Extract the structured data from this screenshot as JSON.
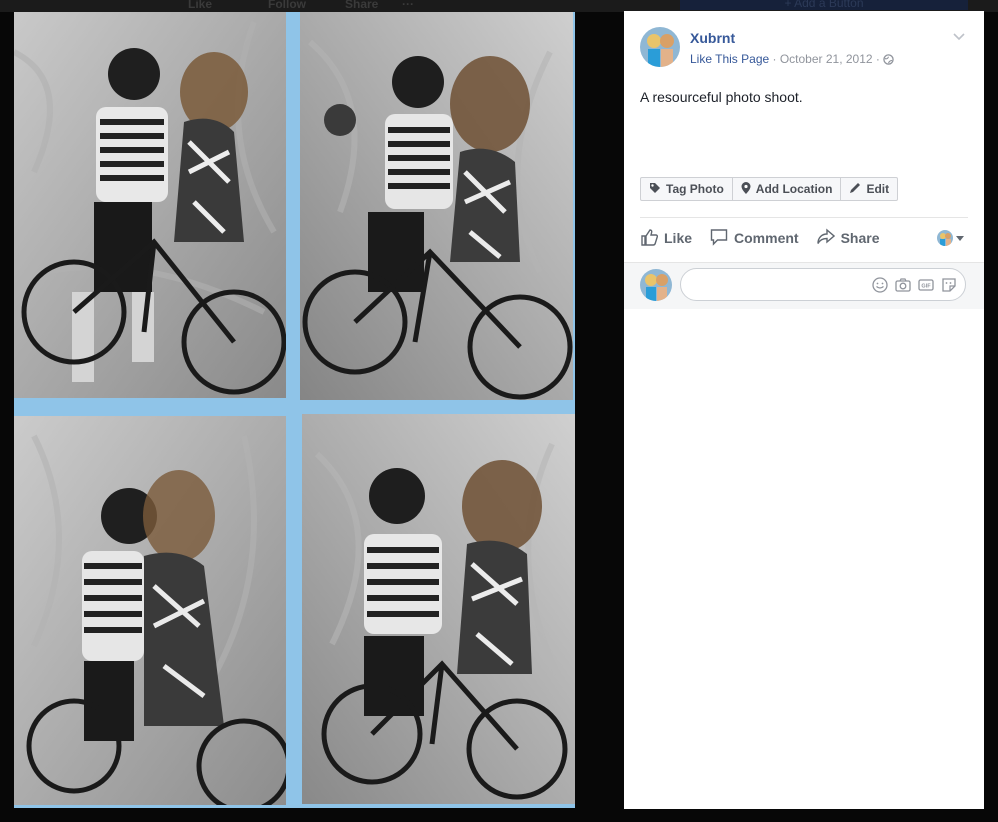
{
  "background_page": {
    "links": [
      "Like",
      "Follow",
      "Share",
      "···"
    ],
    "add_button_label": "+ Add a Button"
  },
  "photo": {
    "description_icons": [
      "photo-panel-1",
      "photo-panel-2",
      "photo-panel-3",
      "photo-panel-4"
    ]
  },
  "post": {
    "page_name": "Xubrnt",
    "like_page": "Like This Page",
    "separator": " · ",
    "date": "October 21, 2012",
    "audience_icon": "globe-icon",
    "caption": "A resourceful photo shoot."
  },
  "tag_bar": {
    "tag_photo": "Tag Photo",
    "add_location": "Add Location",
    "edit": "Edit"
  },
  "actions": {
    "like": "Like",
    "comment": "Comment",
    "share": "Share"
  },
  "comment_box": {
    "placeholder": "",
    "icons": [
      "emoji-icon",
      "camera-icon",
      "gif-icon",
      "sticker-icon"
    ]
  },
  "colors": {
    "link": "#365899",
    "photo_border": "#8fc4e8",
    "meta": "#90949c"
  }
}
